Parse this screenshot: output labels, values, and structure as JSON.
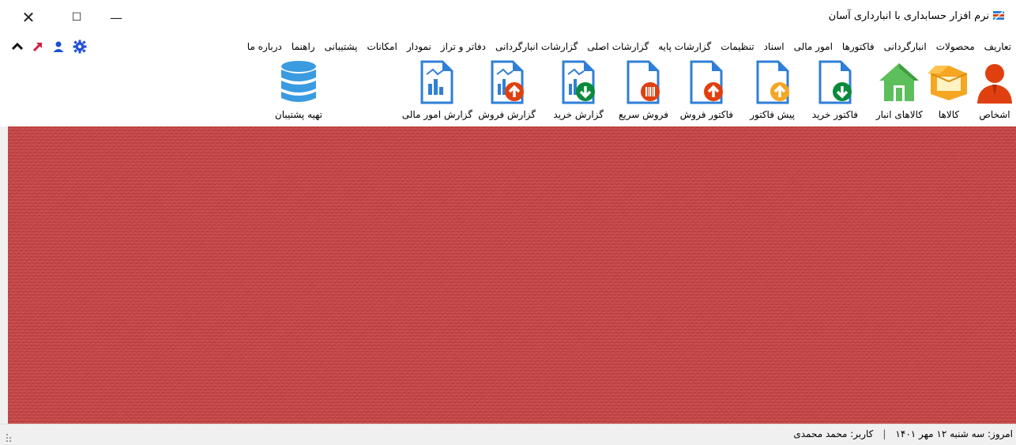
{
  "window": {
    "title": "نرم افزار حسابداری با انبارداری آسان",
    "controls": {
      "close": "✕",
      "maximize": "☐",
      "minimize": "—"
    }
  },
  "menu": {
    "items": [
      "تعاریف",
      "محصولات",
      "انبارگردانی",
      "فاکتورها",
      "امور مالی",
      "اسناد",
      "تنظیمات",
      "گزارشات پایه",
      "گزارشات اصلی",
      "گزارشات انبارگردانی",
      "دفاتر و تراز",
      "نمودار",
      "امکانات",
      "پشتیبانی",
      "راهنما",
      "درباره ما"
    ],
    "tool_icons": [
      "gear-icon",
      "user-icon",
      "arrow-up-right-icon",
      "chevron-up-icon"
    ]
  },
  "toolbar": {
    "items": [
      {
        "label": "اشخاص",
        "icon": "person-icon",
        "color": "#e0400f"
      },
      {
        "label": "کالاها",
        "icon": "box-icon",
        "color": "#f5a623"
      },
      {
        "label": "کالاهای انبار",
        "icon": "warehouse-icon",
        "color": "#5cbf5c"
      },
      {
        "label": "فاکتور خرید",
        "icon": "purchase-invoice-icon",
        "color": "#0a8a3a"
      },
      {
        "label": "پیش فاکتور",
        "icon": "proforma-invoice-icon",
        "color": "#f5a623"
      },
      {
        "label": "فاکتور فروش",
        "icon": "sales-invoice-icon",
        "color": "#e0400f"
      },
      {
        "label": "فروش سریع",
        "icon": "quick-sale-icon",
        "color": "#e0400f"
      },
      {
        "label": "گزارش خرید",
        "icon": "purchase-report-icon",
        "color": "#0a8a3a"
      },
      {
        "label": "گزارش فروش",
        "icon": "sales-report-icon",
        "color": "#e0400f"
      },
      {
        "label": "گزارش امور مالی",
        "icon": "finance-report-icon",
        "color": "#2f7fd6"
      },
      {
        "label": "تهیه پشتیبان",
        "icon": "database-backup-icon",
        "color": "#3a9be0"
      }
    ]
  },
  "status": {
    "date_text": "امروز: سه شنبه ۱۲ مهر ۱۴۰۱",
    "separator": "|",
    "user_text": "کاربر: محمد محمدی"
  },
  "colors": {
    "background_red": "#c74444",
    "doc_blue": "#2f7fd6",
    "accent_orange": "#e0400f",
    "accent_green": "#0a8a3a"
  }
}
